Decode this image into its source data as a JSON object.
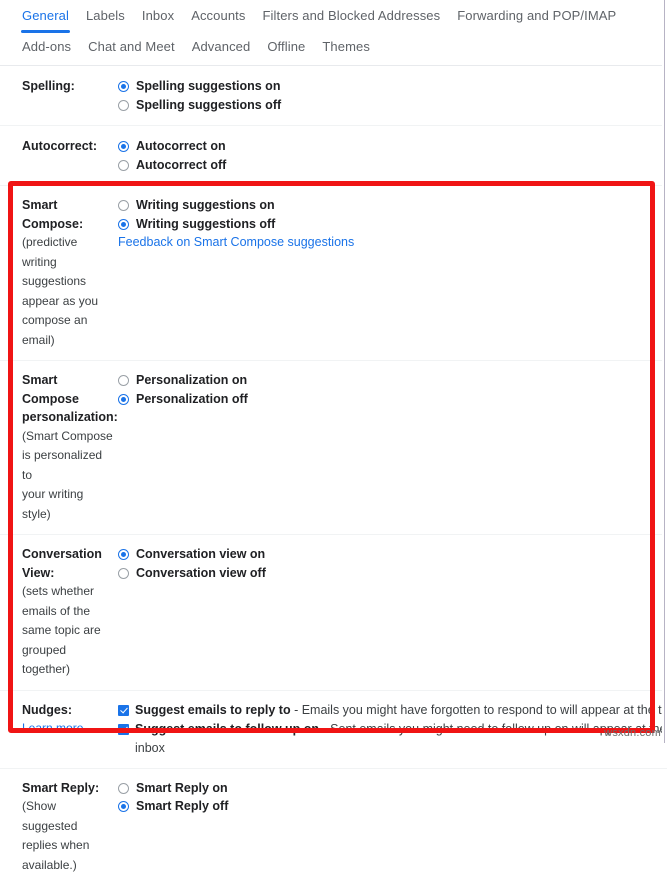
{
  "tabs": {
    "row1": [
      {
        "label": "General",
        "active": true
      },
      {
        "label": "Labels",
        "active": false
      },
      {
        "label": "Inbox",
        "active": false
      },
      {
        "label": "Accounts",
        "active": false
      },
      {
        "label": "Filters and Blocked Addresses",
        "active": false
      },
      {
        "label": "Forwarding and POP/IMAP",
        "active": false
      }
    ],
    "row2": [
      {
        "label": "Add-ons",
        "active": false
      },
      {
        "label": "Chat and Meet",
        "active": false
      },
      {
        "label": "Advanced",
        "active": false
      },
      {
        "label": "Offline",
        "active": false
      },
      {
        "label": "Themes",
        "active": false
      }
    ]
  },
  "settings": {
    "spelling": {
      "label": "Spelling:",
      "option_on": "Spelling suggestions on",
      "option_off": "Spelling suggestions off",
      "selected": "on"
    },
    "autocorrect": {
      "label": "Autocorrect:",
      "option_on": "Autocorrect on",
      "option_off": "Autocorrect off",
      "selected": "on"
    },
    "smart_compose": {
      "label_line1": "Smart",
      "label_line2": "Compose:",
      "desc_line1": "(predictive writing",
      "desc_line2": "suggestions",
      "desc_line3": "appear as you",
      "desc_line4": "compose an",
      "desc_line5": "email)",
      "option_on": "Writing suggestions on",
      "option_off": "Writing suggestions off",
      "selected": "off",
      "feedback_link": "Feedback on Smart Compose suggestions"
    },
    "smart_compose_personalization": {
      "label_line1": "Smart Compose",
      "label_line2": "personalization:",
      "desc_line1": "(Smart Compose",
      "desc_line2": "is personalized to",
      "desc_line3": "your writing style)",
      "option_on": "Personalization on",
      "option_off": "Personalization off",
      "selected": "off"
    },
    "conversation_view": {
      "label_line1": "Conversation",
      "label_line2": "View:",
      "desc_line1": "(sets whether",
      "desc_line2": "emails of the",
      "desc_line3": "same topic are",
      "desc_line4": "grouped together)",
      "option_on": "Conversation view on",
      "option_off": "Conversation view off",
      "selected": "on"
    },
    "nudges": {
      "label": "Nudges:",
      "learn_more": "Learn more",
      "item1_bold": "Suggest emails to reply to",
      "item1_desc": " - Emails you might have forgotten to respond to will appear at the top of your inbox",
      "item1_checked": true,
      "item2_bold": "Suggest emails to follow up on",
      "item2_desc": " - Sent emails you might need to follow up on will appear at the top of your",
      "item2_wrap": "inbox",
      "item2_checked": true
    },
    "smart_reply": {
      "label": "Smart Reply:",
      "desc_line1": "(Show suggested",
      "desc_line2": "replies when",
      "desc_line3": "available.)",
      "option_on": "Smart Reply on",
      "option_off": "Smart Reply off",
      "selected": "off"
    }
  },
  "watermark": "wsxdn.com",
  "colors": {
    "accent": "#1a73e8",
    "annotation": "#f01414"
  }
}
